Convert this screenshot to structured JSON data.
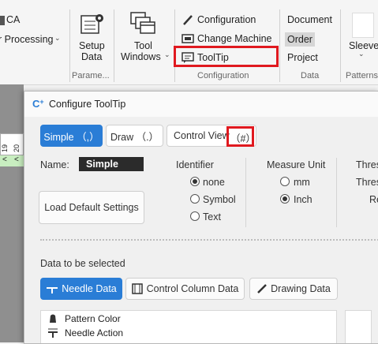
{
  "ribbon": {
    "ca_label": "CA",
    "processing_label": "r Processing",
    "setup_data": [
      "Setup",
      "Data"
    ],
    "tool_windows": [
      "Tool",
      "Windows"
    ],
    "param_group": "Parame...",
    "configuration_btn": "Configuration",
    "change_machine_btn": "Change Machine",
    "tooltip_btn": "ToolTip",
    "configuration_group": "Configuration",
    "document_btn": "Document",
    "order_btn": "Order",
    "project_btn": "Project",
    "data_group": "Data",
    "sleeve_btn": "Sleeve",
    "patterns_group": "Patterns"
  },
  "leftstrip": {
    "col_a": "19",
    "col_b": "20",
    "arrow": "<"
  },
  "dialog": {
    "title": "Configure ToolTip",
    "tabs": [
      {
        "label": "Simple （,）",
        "active": true
      },
      {
        "label": "Draw （.）",
        "active": false
      },
      {
        "label": "Control View",
        "active": false
      }
    ],
    "control_view_key": "（#）",
    "name_label": "Name:",
    "name_value": "Simple",
    "load_default": "Load Default Settings",
    "identifier": {
      "title": "Identifier",
      "options": [
        "none",
        "Symbol",
        "Text"
      ],
      "selected": "none"
    },
    "measure_unit": {
      "title": "Measure Unit",
      "options": [
        "mm",
        "Inch"
      ],
      "selected": "Inch"
    },
    "threshold_cut": [
      "Thres",
      "Thres",
      "Re"
    ],
    "data_to_select": "Data to be selected",
    "data_buttons": [
      {
        "label": "Needle Data",
        "active": true
      },
      {
        "label": "Control Column Data",
        "active": false
      },
      {
        "label": "Drawing Data",
        "active": false
      }
    ],
    "list_items": [
      "Pattern Color",
      "Needle Action"
    ]
  },
  "colors": {
    "accent": "#2a7dd6",
    "highlight": "#e0191f",
    "name_bg": "#2b2b2b"
  }
}
